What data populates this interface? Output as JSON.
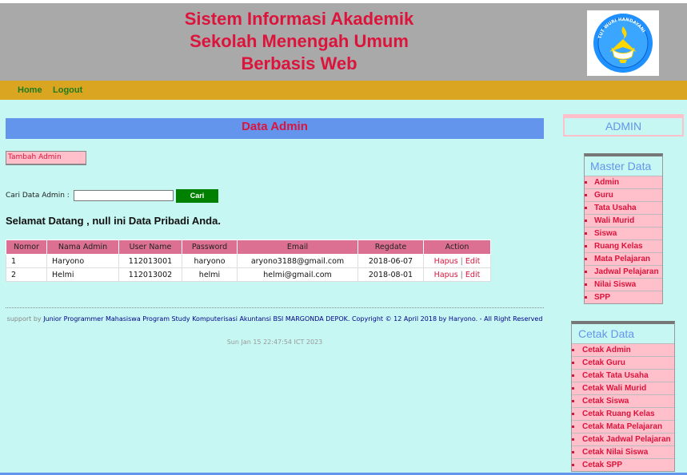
{
  "header": {
    "title_line1": "Sistem Informasi Akademik",
    "title_line2": "Sekolah Menengah Umum",
    "title_line3": "Berbasis Web",
    "logo_text": "TUT WURI HANDAYANI"
  },
  "nav": {
    "home": "Home",
    "logout": "Logout"
  },
  "main": {
    "heading": "Data Admin",
    "add_button": "Tambah Admin",
    "search_label": "Cari Data Admin :",
    "search_value": "",
    "search_button": "Cari",
    "welcome": "Selamat Datang , null ini Data Pribadi Anda."
  },
  "table": {
    "headers": [
      "Nomor",
      "Nama Admin",
      "User Name",
      "Password",
      "Email",
      "Regdate",
      "Action"
    ],
    "rows": [
      {
        "nomor": "1",
        "nama": "Haryono",
        "username": "112013001",
        "password": "haryono",
        "email": "aryono3188@gmail.com",
        "regdate": "2018-06-07"
      },
      {
        "nomor": "2",
        "nama": "Helmi",
        "username": "112013002",
        "password": "helmi",
        "email": "helmi@gmail.com",
        "regdate": "2018-08-01"
      }
    ],
    "action_hapus": "Hapus",
    "action_sep": "|",
    "action_edit": "Edit"
  },
  "footer": {
    "support_by": "support by",
    "text": "Junior Programmer Mahasiswa Program Study Komputerisasi Akuntansi BSI MARGONDA DEPOK. Copyright © 12 April 2018 by Haryono. - All Right Reserved",
    "date": "Sun Jan 15 22:47:54 ICT 2023"
  },
  "sidebar": {
    "admin_label": "ADMIN",
    "master": {
      "title": "Master Data",
      "items": [
        "Admin",
        "Guru",
        "Tata Usaha",
        "Wali Murid",
        "Siswa",
        "Ruang Kelas",
        "Mata Pelajaran",
        "Jadwal Pelajaran",
        "Nilai Siswa",
        "SPP"
      ]
    },
    "cetak": {
      "title": "Cetak Data",
      "items": [
        "Cetak Admin",
        "Cetak Guru",
        "Cetak Tata Usaha",
        "Cetak Wali Murid",
        "Cetak Siswa",
        "Cetak Ruang Kelas",
        "Cetak Mata Pelajaran",
        "Cetak Jadwal Pelajaran",
        "Cetak Nilai Siswa",
        "Cetak SPP"
      ]
    }
  },
  "colors": {
    "header_bg": "#a9a9a9",
    "nav_bg": "#daa520",
    "page_bg": "#c6f7f2",
    "title_red": "#dc143c",
    "heading_blue": "#6495ed",
    "table_header": "#db7093",
    "menu_pink": "#ffc0cb",
    "button_green": "#008000"
  },
  "icons": {
    "logo": "tut-wuri-handayani-logo"
  }
}
